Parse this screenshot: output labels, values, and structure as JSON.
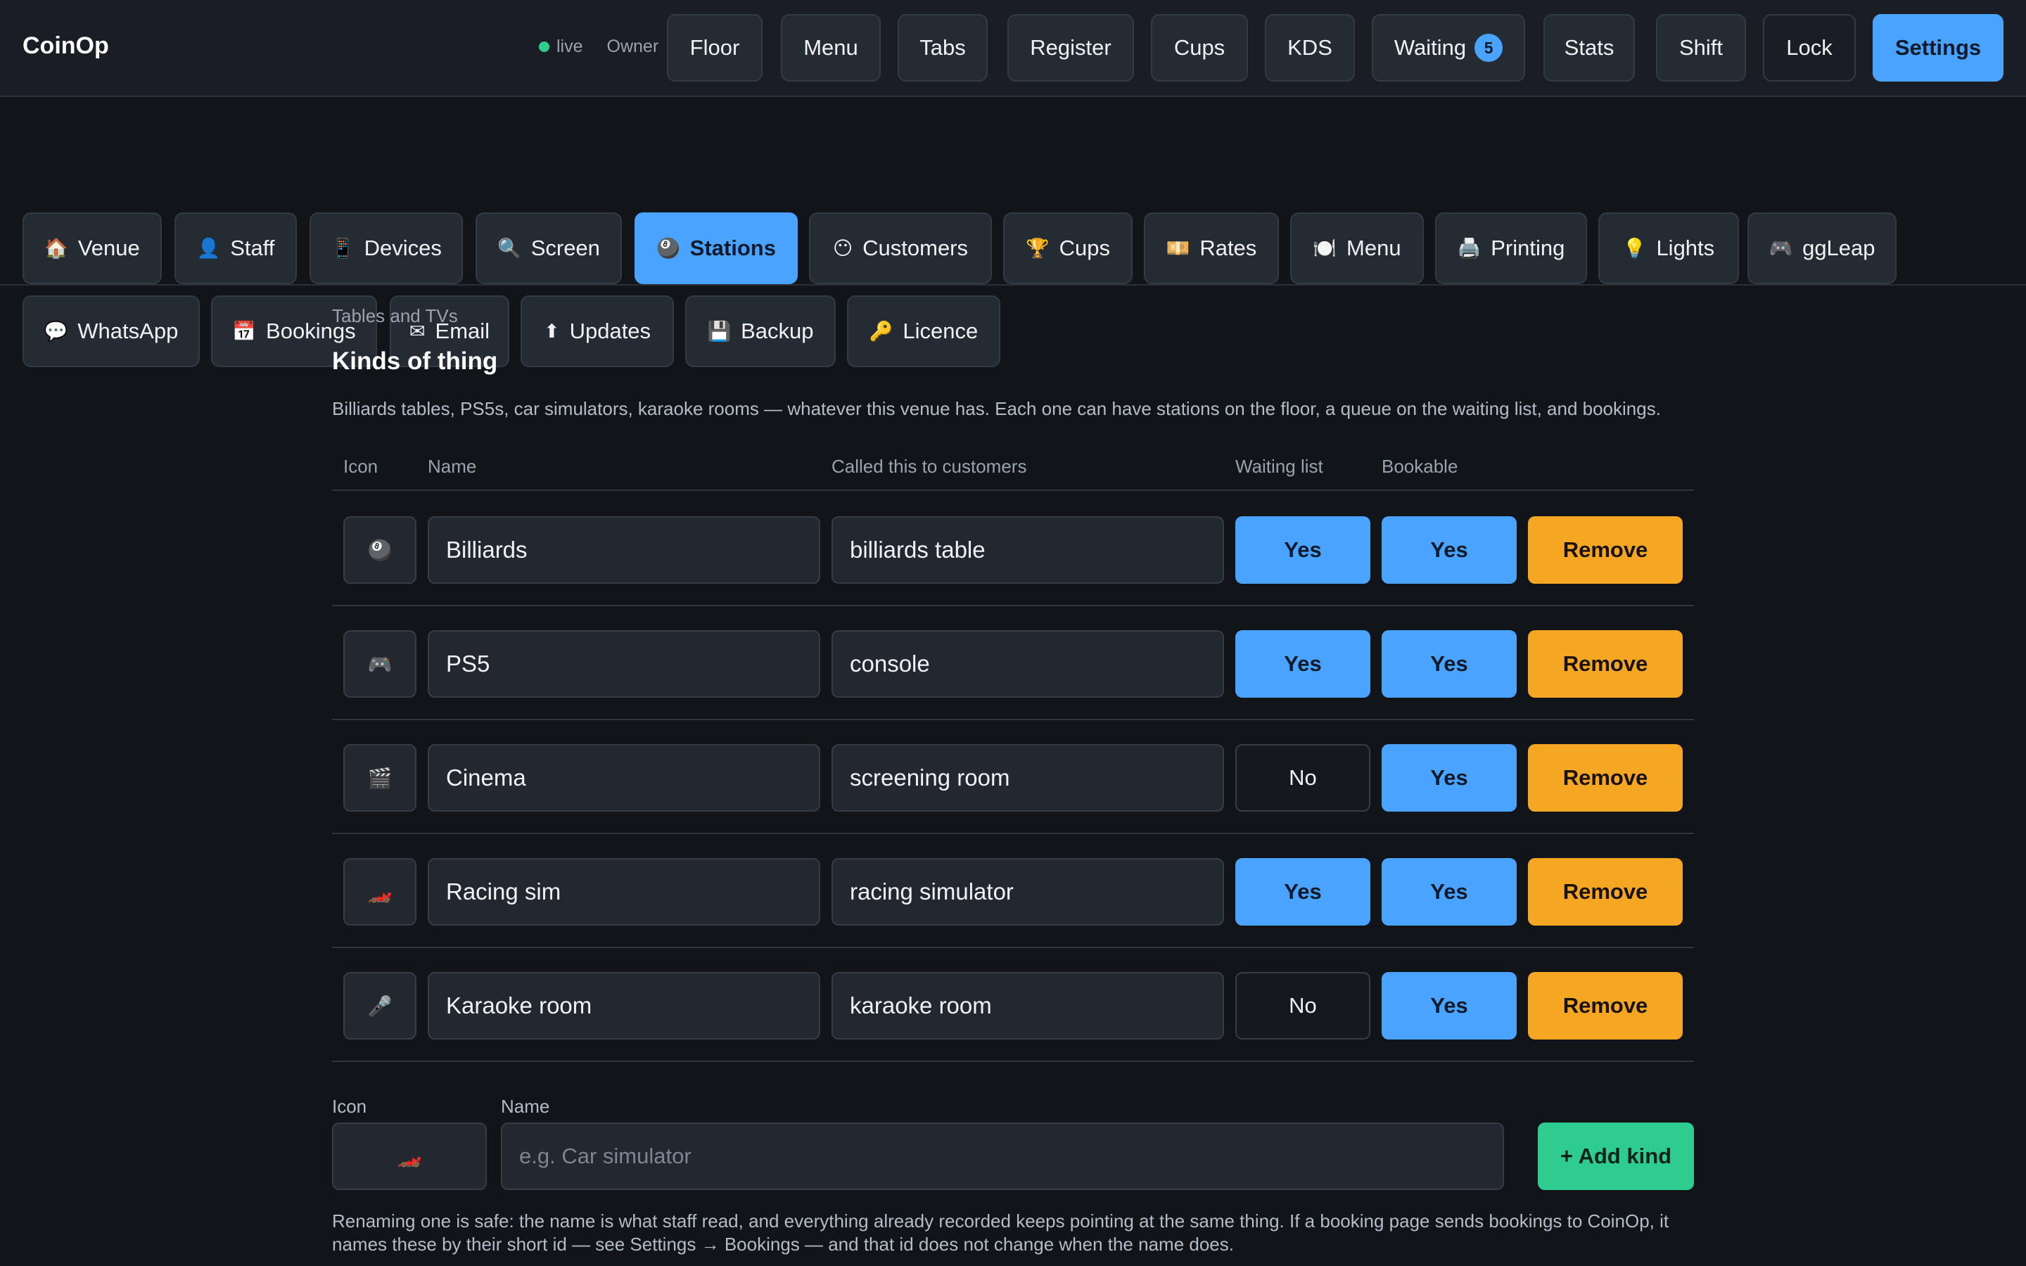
{
  "app": {
    "title": "CoinOp",
    "status": "live",
    "role": "Owner"
  },
  "nav": [
    {
      "label": "Floor"
    },
    {
      "label": "Menu"
    },
    {
      "label": "Tabs"
    },
    {
      "label": "Register"
    },
    {
      "label": "Cups"
    },
    {
      "label": "KDS"
    },
    {
      "label": "Waiting",
      "badge": "5"
    },
    {
      "label": "Stats"
    },
    {
      "label": "Shift"
    },
    {
      "label": "Lock"
    },
    {
      "label": "Settings",
      "active": true
    }
  ],
  "settings_tabs": [
    {
      "icon": "🏠",
      "label": "Venue"
    },
    {
      "icon": "👤",
      "label": "Staff"
    },
    {
      "icon": "📱",
      "label": "Devices"
    },
    {
      "icon": "🔍",
      "label": "Screen"
    },
    {
      "icon": "🎱",
      "label": "Stations",
      "active": true
    },
    {
      "icon": "😶",
      "label": "Customers"
    },
    {
      "icon": "🏆",
      "label": "Cups"
    },
    {
      "icon": "💴",
      "label": "Rates"
    },
    {
      "icon": "🍽️",
      "label": "Menu"
    },
    {
      "icon": "🖨️",
      "label": "Printing"
    },
    {
      "icon": "💡",
      "label": "Lights"
    },
    {
      "icon": "🎮",
      "label": "ggLeap"
    },
    {
      "icon": "💬",
      "label": "WhatsApp"
    },
    {
      "icon": "📅",
      "label": "Bookings"
    },
    {
      "icon": "✉",
      "label": "Email"
    },
    {
      "icon": "⬆",
      "label": "Updates"
    },
    {
      "icon": "💾",
      "label": "Backup"
    },
    {
      "icon": "🔑",
      "label": "Licence"
    }
  ],
  "section": {
    "eyebrow": "Tables and TVs",
    "title": "Kinds of thing",
    "description": "Billiards tables, PS5s, car simulators, karaoke rooms — whatever this venue has. Each one can have stations on the floor, a queue on the waiting list, and bookings."
  },
  "table": {
    "headers": {
      "icon": "Icon",
      "name": "Name",
      "called": "Called this to customers",
      "waiting": "Waiting list",
      "bookable": "Bookable"
    },
    "remove_label": "Remove",
    "rows": [
      {
        "icon": "🎱",
        "name": "Billiards",
        "called": "billiards table",
        "waiting": "Yes",
        "bookable": "Yes"
      },
      {
        "icon": "🎮",
        "name": "PS5",
        "called": "console",
        "waiting": "Yes",
        "bookable": "Yes"
      },
      {
        "icon": "🎬",
        "name": "Cinema",
        "called": "screening room",
        "waiting": "No",
        "bookable": "Yes"
      },
      {
        "icon": "🏎️",
        "name": "Racing sim",
        "called": "racing simulator",
        "waiting": "Yes",
        "bookable": "Yes"
      },
      {
        "icon": "🎤",
        "name": "Karaoke room",
        "called": "karaoke room",
        "waiting": "No",
        "bookable": "Yes"
      }
    ]
  },
  "add_form": {
    "icon_label": "Icon",
    "icon_value": "🏎️",
    "name_label": "Name",
    "name_placeholder": "e.g. Car simulator",
    "name_value": "",
    "button_label": "+ Add kind"
  },
  "note": "Renaming one is safe: the name is what staff read, and everything already recorded keeps pointing at the same thing. If a booking page sends bookings to CoinOp, it names these by their short id — see Settings → Bookings — and that id does not change when the name does."
}
